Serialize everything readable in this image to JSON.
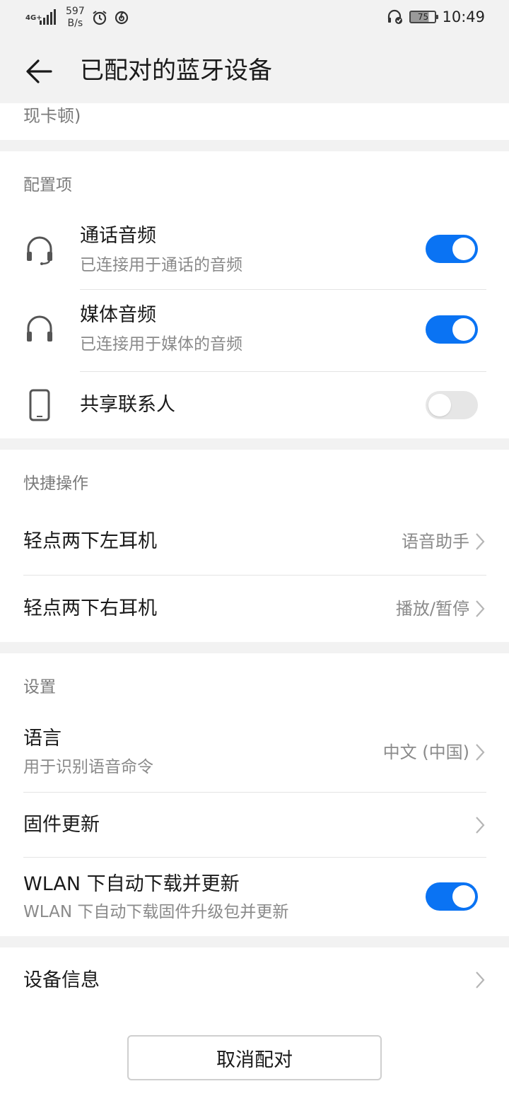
{
  "status_bar": {
    "network_type": "4G+",
    "data_speed_value": "597",
    "data_speed_unit": "B/s",
    "battery_level": "75",
    "time": "10:49"
  },
  "header": {
    "title": "已配对的蓝牙设备"
  },
  "truncated_text": "现卡顿)",
  "config_section": {
    "title": "配置项",
    "items": [
      {
        "title": "通话音频",
        "subtitle": "已连接用于通话的音频",
        "icon": "headset-icon",
        "enabled": true
      },
      {
        "title": "媒体音频",
        "subtitle": "已连接用于媒体的音频",
        "icon": "headphones-icon",
        "enabled": true
      },
      {
        "title": "共享联系人",
        "icon": "phone-icon",
        "enabled": false
      }
    ]
  },
  "quick_section": {
    "title": "快捷操作",
    "items": [
      {
        "title": "轻点两下左耳机",
        "value": "语音助手"
      },
      {
        "title": "轻点两下右耳机",
        "value": "播放/暂停"
      }
    ]
  },
  "settings_section": {
    "title": "设置",
    "items": [
      {
        "title": "语言",
        "subtitle": "用于识别语音命令",
        "value": "中文 (中国)"
      },
      {
        "title": "固件更新"
      },
      {
        "title": "WLAN 下自动下载并更新",
        "subtitle": "WLAN 下自动下载固件升级包并更新",
        "enabled": true
      }
    ]
  },
  "device_info": {
    "title": "设备信息"
  },
  "unpair_button": {
    "label": "取消配对"
  },
  "colors": {
    "accent": "#0a73f3",
    "toggle_off": "#e6e6e6",
    "background": "#f2f2f2",
    "card": "#ffffff",
    "secondary_text": "#8a8a8a"
  }
}
